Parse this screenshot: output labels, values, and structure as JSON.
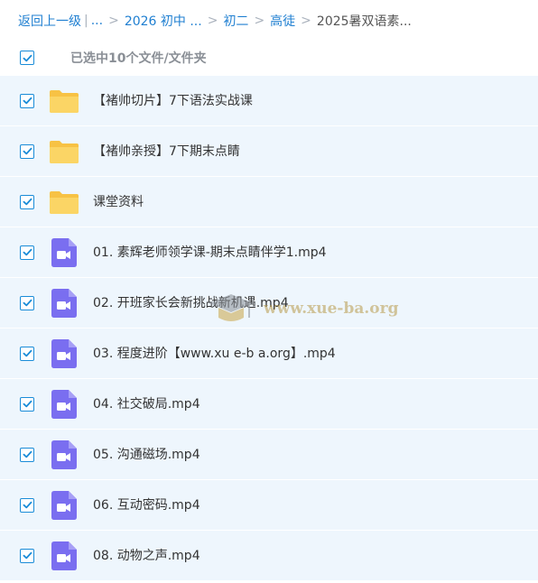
{
  "breadcrumb": {
    "back": "返回上一级",
    "pipe": "|",
    "ellipsis": "...",
    "sep": ">",
    "items": [
      "2026 初中 ...",
      "初二",
      "高徒"
    ],
    "current": "2025暑双语素..."
  },
  "selection": {
    "text": "已选中10个文件/文件夹",
    "all_checked": true
  },
  "files": [
    {
      "name": "【褚帅切片】7下语法实战课",
      "type": "folder",
      "checked": true
    },
    {
      "name": "【褚帅亲授】7下期末点睛",
      "type": "folder",
      "checked": true
    },
    {
      "name": "课堂资料",
      "type": "folder",
      "checked": true
    },
    {
      "name": "01. 素辉老师领学课-期末点睛伴学1.mp4",
      "type": "video",
      "checked": true
    },
    {
      "name": "02. 开班家长会新挑战新机遇.mp4",
      "type": "video",
      "checked": true
    },
    {
      "name": "03. 程度进阶【www.xu e-b a.org】.mp4",
      "type": "video",
      "checked": true
    },
    {
      "name": "04. 社交破局.mp4",
      "type": "video",
      "checked": true
    },
    {
      "name": "05. 沟通磁场.mp4",
      "type": "video",
      "checked": true
    },
    {
      "name": "06. 互动密码.mp4",
      "type": "video",
      "checked": true
    },
    {
      "name": "08. 动物之声.mp4",
      "type": "video",
      "checked": true
    }
  ],
  "watermark": {
    "text": "www.xue-ba.org"
  },
  "colors": {
    "accent": "#1f7fd1",
    "row_bg": "#eef6fd",
    "folder": "#f9cf52",
    "video": "#7a6ef0"
  }
}
